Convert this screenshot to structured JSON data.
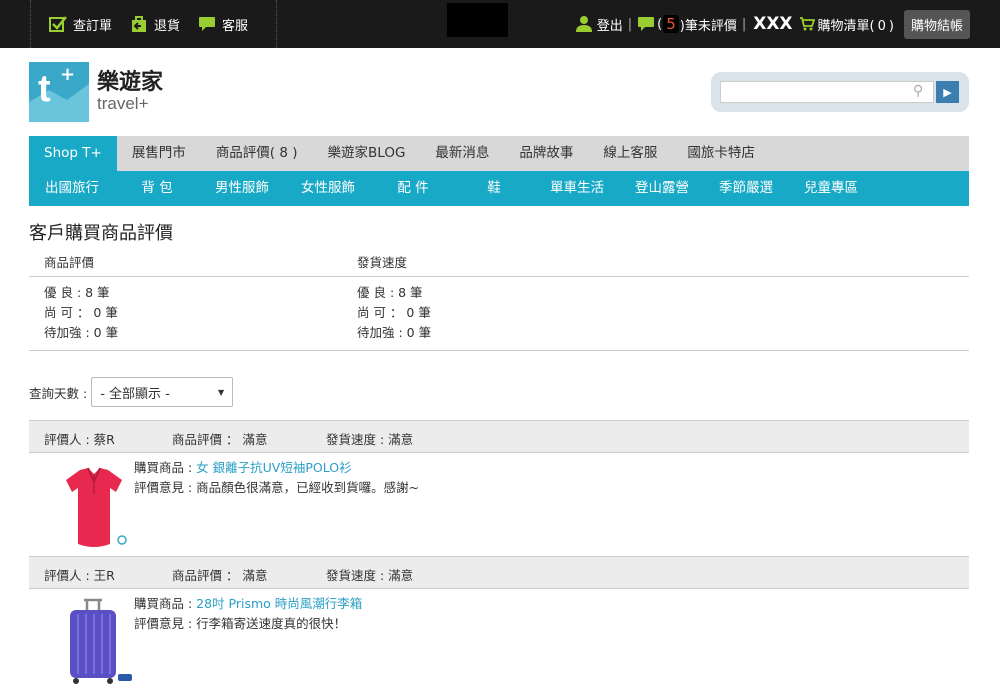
{
  "topbar": {
    "order_query": "查訂單",
    "return": "退貨",
    "service": "客服",
    "logout": "登出",
    "unreviewed_count": "5",
    "unreviewed_suffix": ")筆未評價",
    "username": "XXX",
    "cart_label": "購物清單(",
    "cart_count": "0",
    "cart_close": ")",
    "checkout": "購物結帳"
  },
  "logo": {
    "zh": "樂遊家",
    "en": "travel+",
    "t": "t",
    "plus": "+"
  },
  "search": {
    "placeholder": ""
  },
  "nav_main": [
    "Shop T+",
    "展售門市",
    "商品評價( 8 )",
    "樂遊家BLOG",
    "最新消息",
    "品牌故事",
    "線上客服",
    "國旅卡特店"
  ],
  "nav_sub": [
    "出國旅行",
    "背 包",
    "男性服飾",
    "女性服飾",
    "配 件",
    "鞋",
    "單車生活",
    "登山露營",
    "季節嚴選",
    "兒童專區"
  ],
  "page_title": "客戶購買商品評價",
  "stats": {
    "col1_header": "商品評價",
    "col2_header": "發貨速度",
    "col1": [
      "優 良 : 8 筆",
      "尚 可 ： 0 筆",
      "待加強 : 0 筆"
    ],
    "col2": [
      "優 良 : 8 筆",
      "尚 可 ： 0 筆",
      "待加強 : 0 筆"
    ]
  },
  "filter": {
    "label": "查詢天數 :",
    "selected": "- 全部顯示 -"
  },
  "reviews": [
    {
      "reviewer": "評價人 : 蔡R",
      "product_rating": "商品評價 ： 滿意",
      "shipping_rating": "發貨速度 : 滿意",
      "product_label": "購買商品 : ",
      "product_name": "女 銀離子抗UV短袖POLO衫",
      "comment_label": "評價意見 : ",
      "comment": "商品顏色很滿意，已經收到貨囉。感謝~"
    },
    {
      "reviewer": "評價人 : 王R",
      "product_rating": "商品評價 ： 滿意",
      "shipping_rating": "發貨速度 : 滿意",
      "product_label": "購買商品 : ",
      "product_name": "28吋 Prismo 時尚風潮行李箱",
      "comment_label": "評價意見 : ",
      "comment": "行李箱寄送速度真的很快！"
    }
  ],
  "colors": {
    "accent": "#18a9c6",
    "topbar": "#1a1a1a",
    "link": "#2a9fc6",
    "icon_green": "#9acd32"
  }
}
